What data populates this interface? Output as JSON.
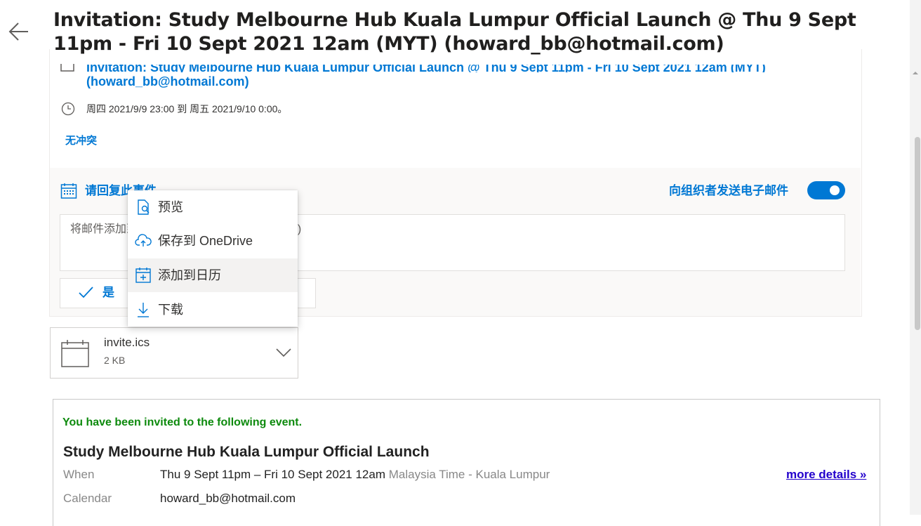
{
  "header": {
    "subject": "Invitation: Study Melbourne Hub Kuala Lumpur Official Launch @ Thu 9 Sept 11pm - Fri 10 Sept 2021 12am (MYT) (howard_bb@hotmail.com)",
    "back_icon": "arrow-left-icon"
  },
  "card": {
    "title_line1": "Invitation: Study Melbourne Hub Kuala Lumpur Official Launch @ Thu 9 Sept 11pm - Fri 10 Sept 2021 12am (MYT)",
    "title_line2": "(howard_bb@hotmail.com)",
    "time": "周四 2021/9/9 23:00 到 周五 2021/9/10 0:00。",
    "no_conflict": "无冲突"
  },
  "response": {
    "title": "请回复此事件",
    "send_email_label": "向组织者发送电子邮件",
    "send_email_on": true,
    "message_placeholder": "将邮件添加到 howard_bb@hotmail.com (可选)",
    "yes_label": "是"
  },
  "menu": {
    "items": [
      {
        "label": "预览",
        "icon": "preview-icon"
      },
      {
        "label": "保存到 OneDrive",
        "icon": "cloud-upload-icon"
      },
      {
        "label": "添加到日历",
        "icon": "calendar-add-icon"
      },
      {
        "label": "下载",
        "icon": "download-icon"
      }
    ],
    "highlighted_index": 2
  },
  "attachment": {
    "name": "invite.ics",
    "size": "2 KB"
  },
  "invite": {
    "intro": "You have been invited to the following event.",
    "event_title": "Study Melbourne Hub Kuala Lumpur Official Launch",
    "when_label": "When",
    "when_value": "Thu 9 Sept 11pm – Fri 10 Sept 2021 12am",
    "when_tz": "Malaysia Time - Kuala Lumpur",
    "calendar_label": "Calendar",
    "calendar_value": "howard_bb@hotmail.com",
    "more_details": "more details »"
  },
  "colors": {
    "accent": "#0078d4",
    "invite_green": "#0d8a0d",
    "link_blue": "#2200cc"
  }
}
